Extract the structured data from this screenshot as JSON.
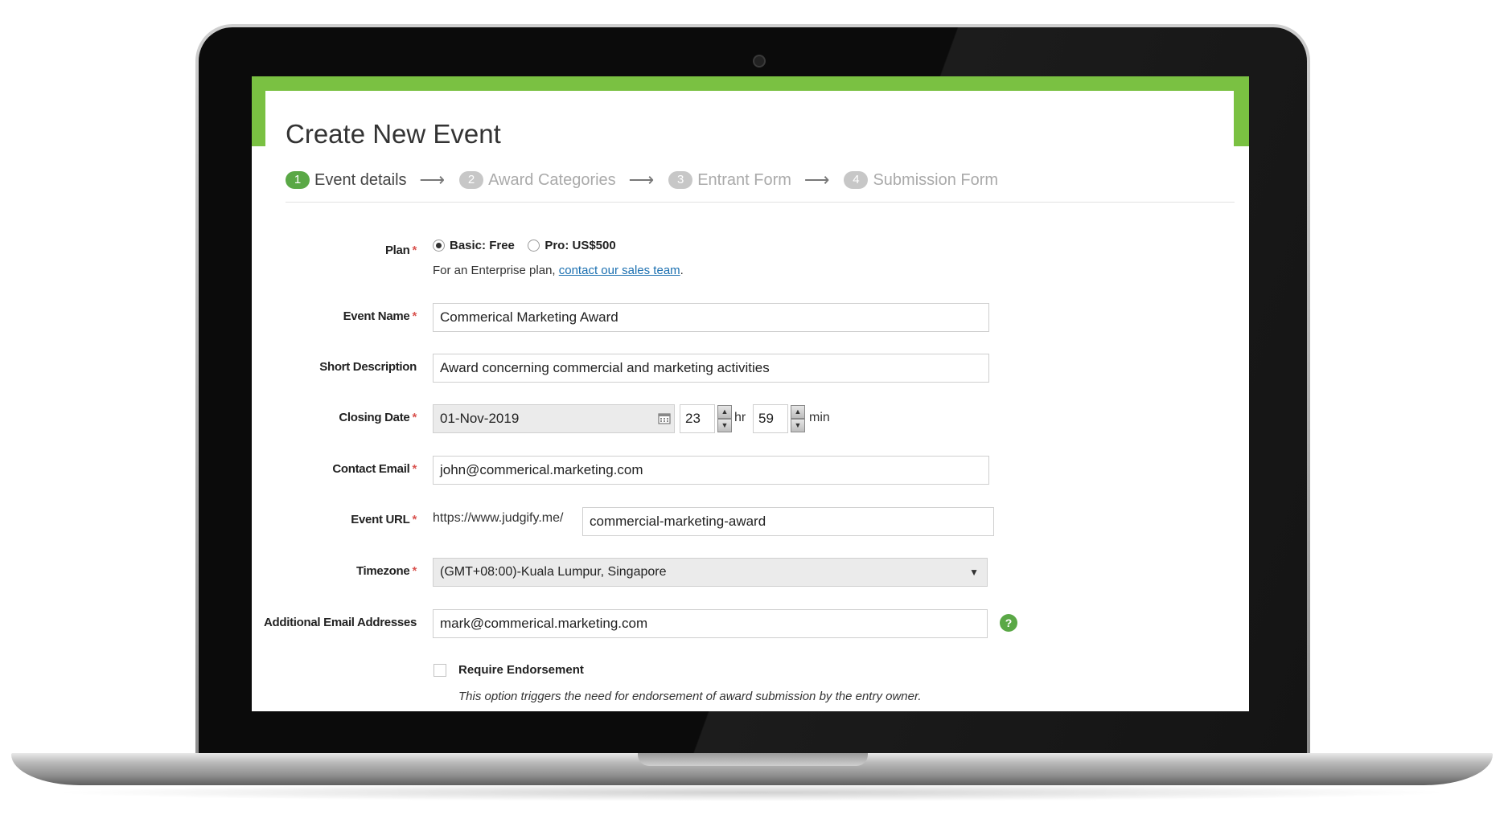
{
  "page": {
    "title": "Create New Event",
    "accent_color": "#7ac142"
  },
  "steps": [
    {
      "num": "1",
      "label": "Event details",
      "active": true
    },
    {
      "num": "2",
      "label": "Award Categories",
      "active": false
    },
    {
      "num": "3",
      "label": "Entrant Form",
      "active": false
    },
    {
      "num": "4",
      "label": "Submission Form",
      "active": false
    }
  ],
  "form": {
    "plan": {
      "label": "Plan",
      "options": [
        "Basic: Free",
        "Pro: US$500"
      ],
      "selected": "Basic: Free",
      "hint_prefix": "For an Enterprise plan,",
      "hint_link": "contact our sales team",
      "hint_suffix": "."
    },
    "event_name": {
      "label": "Event Name",
      "value": "Commerical Marketing Award"
    },
    "short_description": {
      "label": "Short Description",
      "value": "Award concerning commercial and marketing activities"
    },
    "closing_date": {
      "label": "Closing Date",
      "date": "01-Nov-2019",
      "hour": "23",
      "hour_unit": "hr",
      "minute": "59",
      "minute_unit": "min"
    },
    "contact_email": {
      "label": "Contact Email",
      "value": "john@commerical.marketing.com"
    },
    "event_url": {
      "label": "Event URL",
      "prefix": "https://www.judgify.me/",
      "value": "commercial-marketing-award"
    },
    "timezone": {
      "label": "Timezone",
      "value": "(GMT+08:00)-Kuala Lumpur, Singapore"
    },
    "additional_emails": {
      "label": "Additional Email Addresses",
      "value": "mark@commerical.marketing.com",
      "help": "?"
    },
    "endorsement": {
      "label": "Require Endorsement",
      "checked": false,
      "description": "This option triggers the need for endorsement of award submission by the entry owner."
    }
  },
  "required_mark": "*"
}
